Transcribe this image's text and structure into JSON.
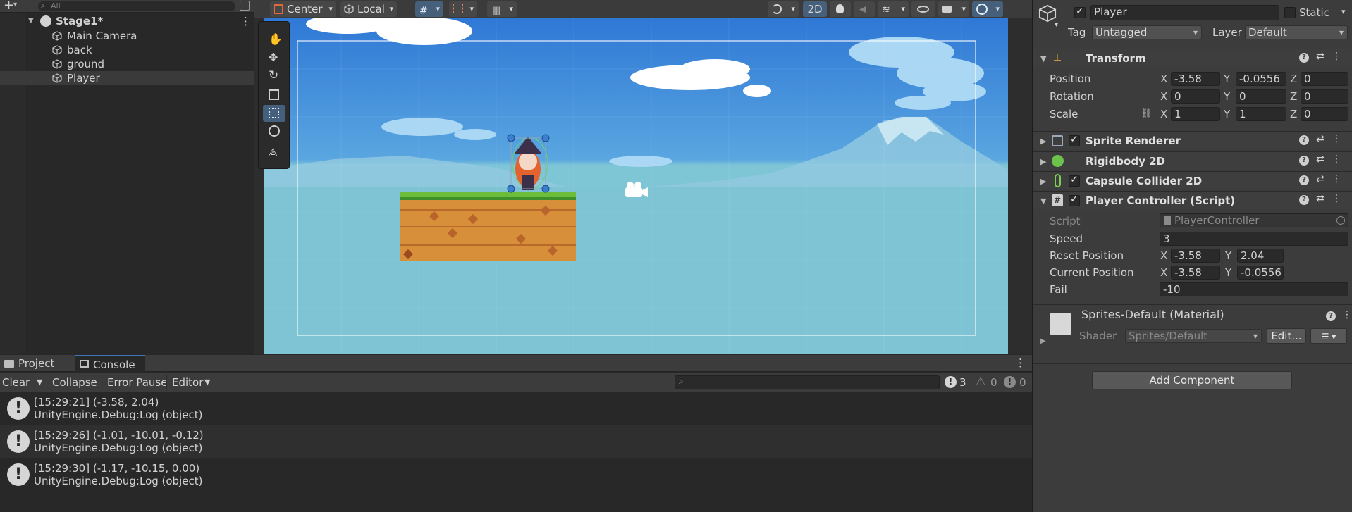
{
  "hierarchy": {
    "search_placeholder": "All",
    "scene_name": "Stage1*",
    "items": [
      {
        "label": "Main Camera"
      },
      {
        "label": "back"
      },
      {
        "label": "ground"
      },
      {
        "label": "Player"
      }
    ]
  },
  "scene_toolbar": {
    "pivot": "Center",
    "space": "Local",
    "mode_2d": "2D"
  },
  "bottom_panel": {
    "tabs": [
      "Project",
      "Console"
    ],
    "active_tab": "Console",
    "toolbar": {
      "clear": "Clear",
      "collapse": "Collapse",
      "error_pause": "Error Pause",
      "editor": "Editor"
    },
    "counts": {
      "warnings_log": "3",
      "warnings": "0",
      "errors": "0"
    },
    "logs": [
      {
        "line1": "[15:29:21] (-3.58, 2.04)",
        "line2": "UnityEngine.Debug:Log (object)"
      },
      {
        "line1": "[15:29:26] (-1.01, -10.01, -0.12)",
        "line2": "UnityEngine.Debug:Log (object)"
      },
      {
        "line1": "[15:29:30] (-1.17, -10.15, 0.00)",
        "line2": "UnityEngine.Debug:Log (object)"
      }
    ]
  },
  "inspector": {
    "object_name": "Player",
    "static_label": "Static",
    "tag_label": "Tag",
    "tag_value": "Untagged",
    "layer_label": "Layer",
    "layer_value": "Default",
    "transform": {
      "title": "Transform",
      "position_label": "Position",
      "rotation_label": "Rotation",
      "scale_label": "Scale",
      "position": {
        "x": "-3.58",
        "y": "-0.0556",
        "z": "0"
      },
      "rotation": {
        "x": "0",
        "y": "0",
        "z": "0"
      },
      "scale": {
        "x": "1",
        "y": "1",
        "z": "0"
      }
    },
    "components": {
      "sprite_renderer": "Sprite Renderer",
      "rigidbody": "Rigidbody 2D",
      "capsule": "Capsule Collider 2D",
      "controller": "Player Controller (Script)"
    },
    "controller": {
      "script_label": "Script",
      "script_value": "PlayerController",
      "speed_label": "Speed",
      "speed_value": "3",
      "reset_label": "Reset Position",
      "reset": {
        "x": "-3.58",
        "y": "2.04"
      },
      "current_label": "Current Position",
      "current": {
        "x": "-3.58",
        "y": "-0.0556"
      },
      "fail_label": "Fail",
      "fail_value": "-10"
    },
    "material": {
      "title": "Sprites-Default (Material)",
      "shader_label": "Shader",
      "shader_value": "Sprites/Default",
      "edit_label": "Edit..."
    },
    "add_component": "Add Component",
    "axis": {
      "x": "X",
      "y": "Y",
      "z": "Z"
    }
  },
  "colors": {
    "sky_top": "#2f78d6",
    "sky_bottom": "#7ec6d6",
    "accent": "#3a79bb",
    "mountain": "#8fc8e0"
  }
}
